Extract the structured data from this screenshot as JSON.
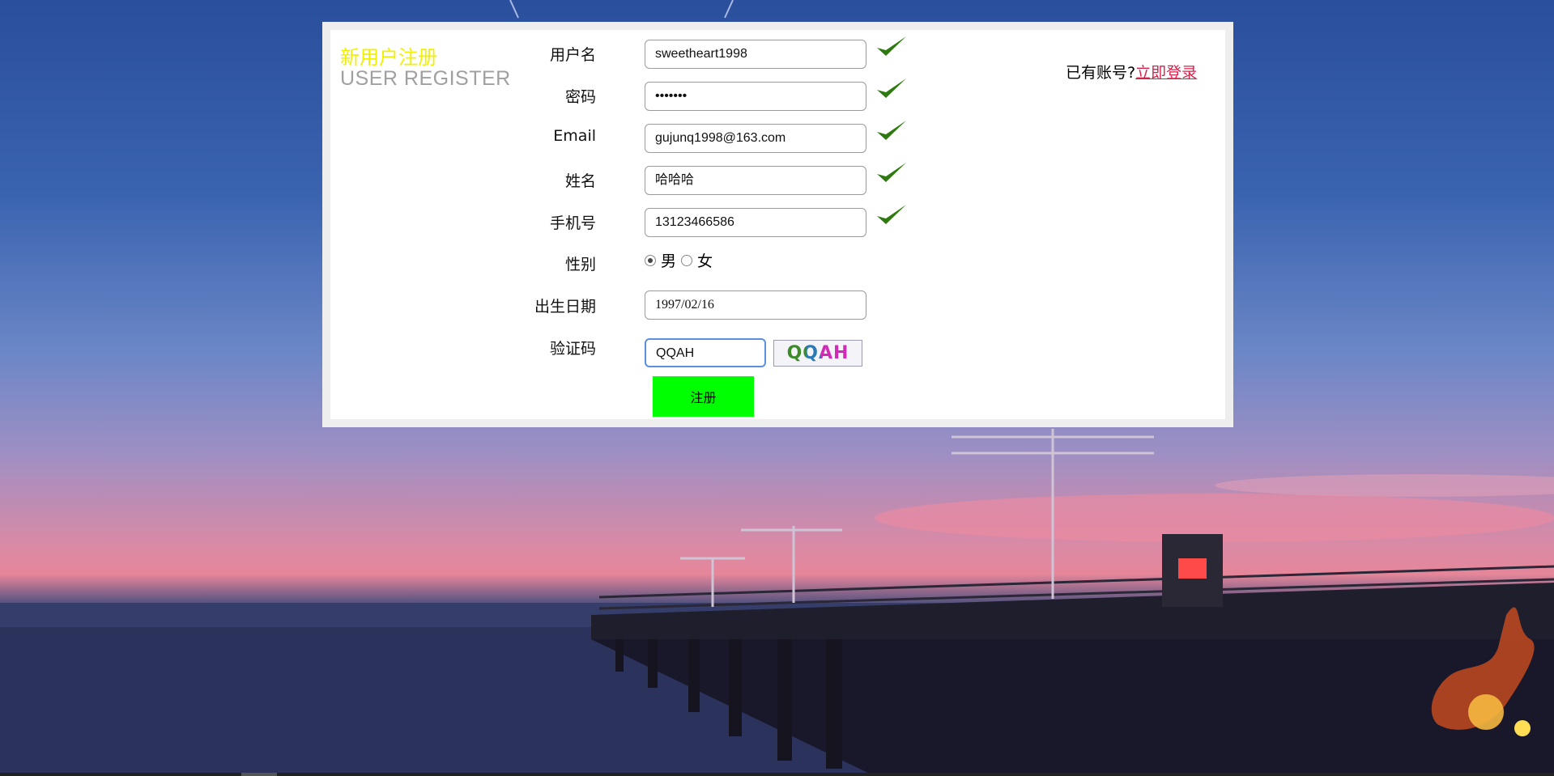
{
  "header": {
    "title_cn": "新用户注册",
    "title_en": "USER REGISTER",
    "login_prompt": "已有账号?",
    "login_link": "立即登录"
  },
  "form": {
    "username": {
      "label": "用户名",
      "value": "sweetheart1998"
    },
    "password": {
      "label": "密码",
      "value": "•••••••"
    },
    "email": {
      "label": "Email",
      "value": "gujunq1998@163.com"
    },
    "name": {
      "label": "姓名",
      "value": "哈哈哈"
    },
    "phone": {
      "label": "手机号",
      "value": "13123466586"
    },
    "gender": {
      "label": "性别",
      "male": "男",
      "female": "女",
      "selected": "男"
    },
    "birthdate": {
      "label": "出生日期",
      "value": "1997/02/16"
    },
    "captcha": {
      "label": "验证码",
      "value": "QQAH",
      "image_text": "QQAH"
    },
    "submit_label": "注册"
  },
  "colors": {
    "title_cn": "#f0f000",
    "title_en": "#a0a0a0",
    "login_link": "#d6224b",
    "submit_bg": "#00ff00",
    "check": "#2f7a10"
  },
  "icons": {
    "check": "checkmark-icon",
    "logo": "game-logo"
  }
}
